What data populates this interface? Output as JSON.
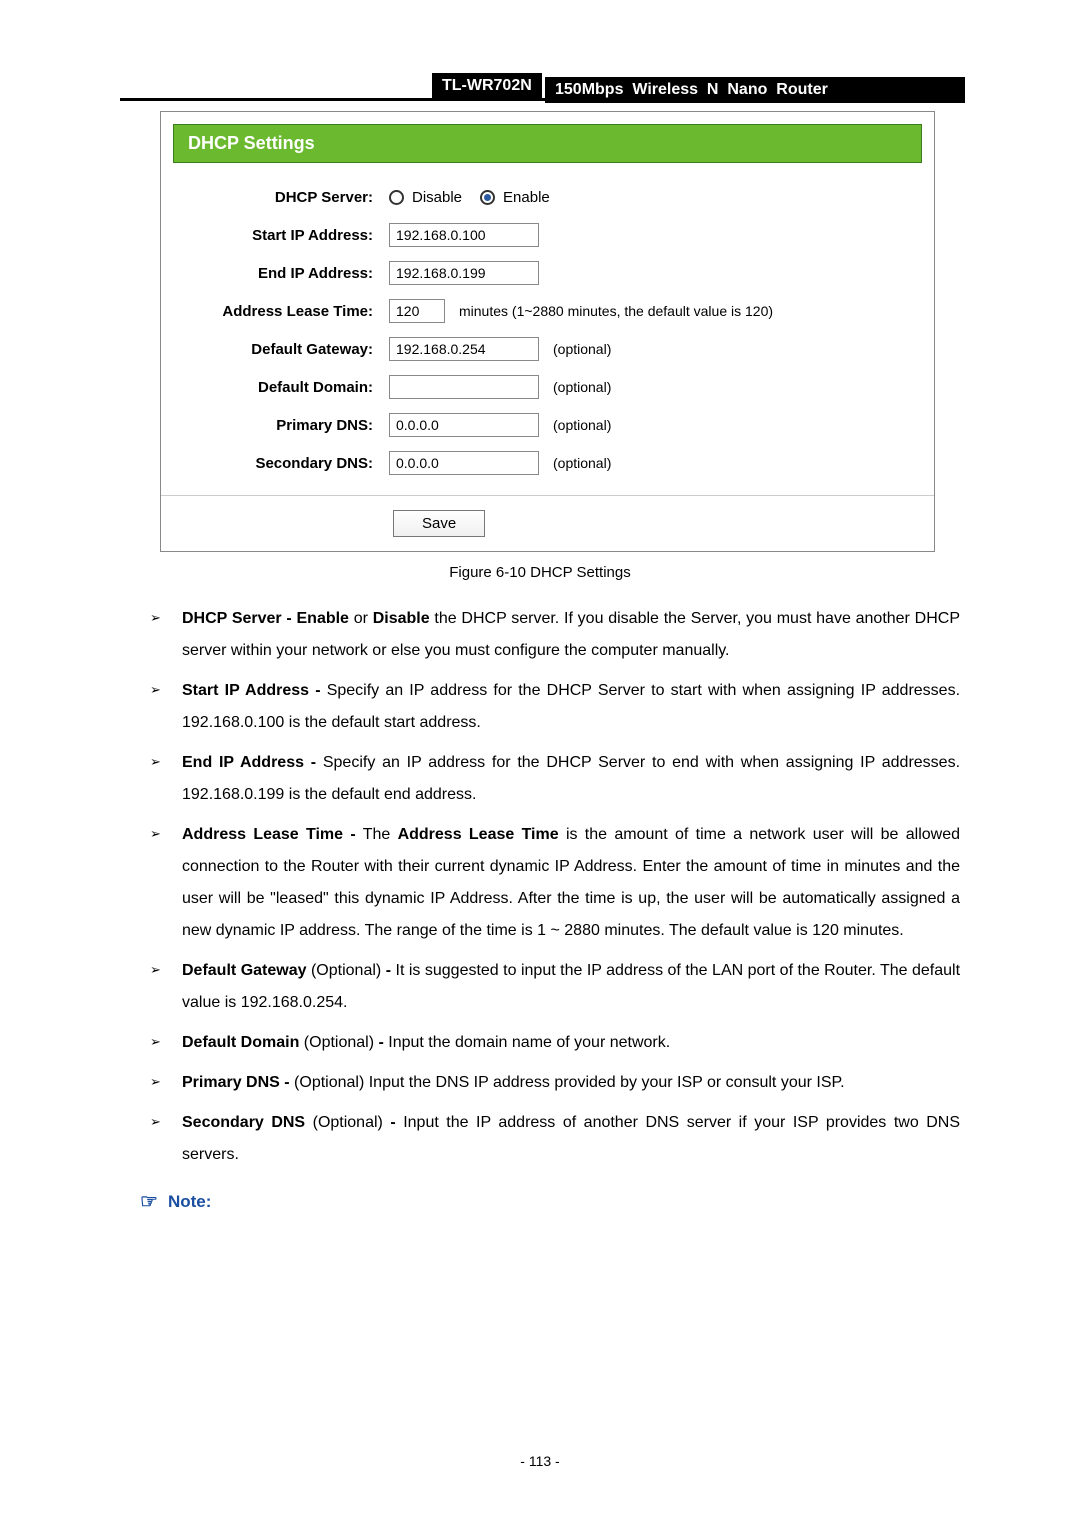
{
  "header": {
    "model": "TL-WR702N",
    "title": "150Mbps  Wireless  N  Nano  Router"
  },
  "panel": {
    "title": "DHCP Settings",
    "labels": {
      "dhcp_server": "DHCP Server:",
      "start_ip": "Start IP Address:",
      "end_ip": "End IP Address:",
      "lease": "Address Lease Time:",
      "gateway": "Default Gateway:",
      "domain": "Default Domain:",
      "pdns": "Primary DNS:",
      "sdns": "Secondary DNS:"
    },
    "radio": {
      "disable": "Disable",
      "enable": "Enable",
      "selected": "enable"
    },
    "values": {
      "start_ip": "192.168.0.100",
      "end_ip": "192.168.0.199",
      "lease": "120",
      "gateway": "192.168.0.254",
      "domain": "",
      "pdns": "0.0.0.0",
      "sdns": "0.0.0.0"
    },
    "trail": {
      "lease": "minutes (1~2880 minutes, the default value is 120)",
      "optional": "(optional)"
    },
    "save": "Save"
  },
  "caption": "Figure 6-10 DHCP Settings",
  "bullets": [
    {
      "b": "DHCP Server - Enable",
      "m": " or ",
      "b2": "Disable",
      "rest": " the DHCP server. If you disable the Server, you must have another DHCP server within your network or else you must configure the computer manually."
    },
    {
      "b": "Start IP Address -",
      "rest": " Specify an IP address for the DHCP Server to start with when assigning IP addresses. 192.168.0.100 is the default start address."
    },
    {
      "b": "End IP Address -",
      "rest": " Specify an IP address for the DHCP Server to end with when assigning IP addresses. 192.168.0.199 is the default end address."
    },
    {
      "b": "Address Lease Time -",
      "m": " The ",
      "b2": "Address Lease Time",
      "rest": " is the amount of time a network user will be allowed connection to the Router with their current dynamic IP Address. Enter the amount of time in minutes and the user will be \"leased\" this dynamic IP Address. After the time is up, the user will be automatically assigned a new dynamic IP address. The range of the time is 1 ~ 2880 minutes. The default value is 120 minutes."
    },
    {
      "b": "Default Gateway",
      "m": " (Optional) ",
      "b2": "-",
      "rest": " It is suggested to input the IP address of the LAN port of the Router. The default value is 192.168.0.254."
    },
    {
      "b": "Default Domain",
      "m": " (Optional) ",
      "b2": "-",
      "rest": " Input the domain name of your network."
    },
    {
      "b": "Primary DNS -",
      "rest": " (Optional) Input the DNS IP address provided by your ISP or consult your ISP."
    },
    {
      "b": "Secondary DNS",
      "m": " (Optional) ",
      "b2": "-",
      "rest": " Input the IP address of another DNS server if your ISP provides two DNS servers."
    }
  ],
  "note_label": "Note:",
  "page_number": "- 113 -"
}
